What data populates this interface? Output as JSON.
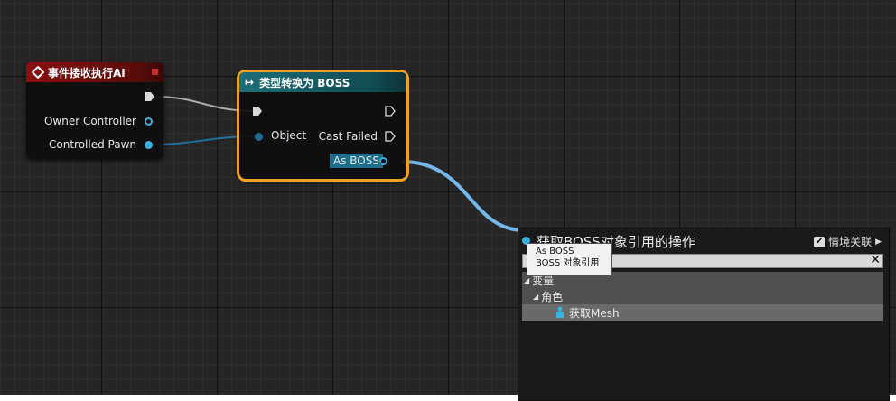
{
  "event_node": {
    "title": "事件接收执行AI",
    "pins": {
      "owner_controller": "Owner Controller",
      "controlled_pawn": "Controlled Pawn"
    }
  },
  "cast_node": {
    "title": "类型转换为 BOSS",
    "pins": {
      "object": "Object",
      "cast_failed": "Cast Failed",
      "as_boss": "As BOSS"
    }
  },
  "action_menu": {
    "title": "获取BOSS对象引用的操作",
    "context_label": "情境关联",
    "context_checked": true,
    "search_value": "",
    "tree": {
      "variables": "变量",
      "character": "角色",
      "get_mesh": "获取Mesh"
    }
  },
  "tooltip": {
    "line1": "As BOSS",
    "line2": "BOSS 对象引用"
  },
  "colors": {
    "event_header": "#8a1010",
    "cast_header": "#1c6e78",
    "selection": "#f0a020",
    "object_pin": "#3ab0e0"
  }
}
